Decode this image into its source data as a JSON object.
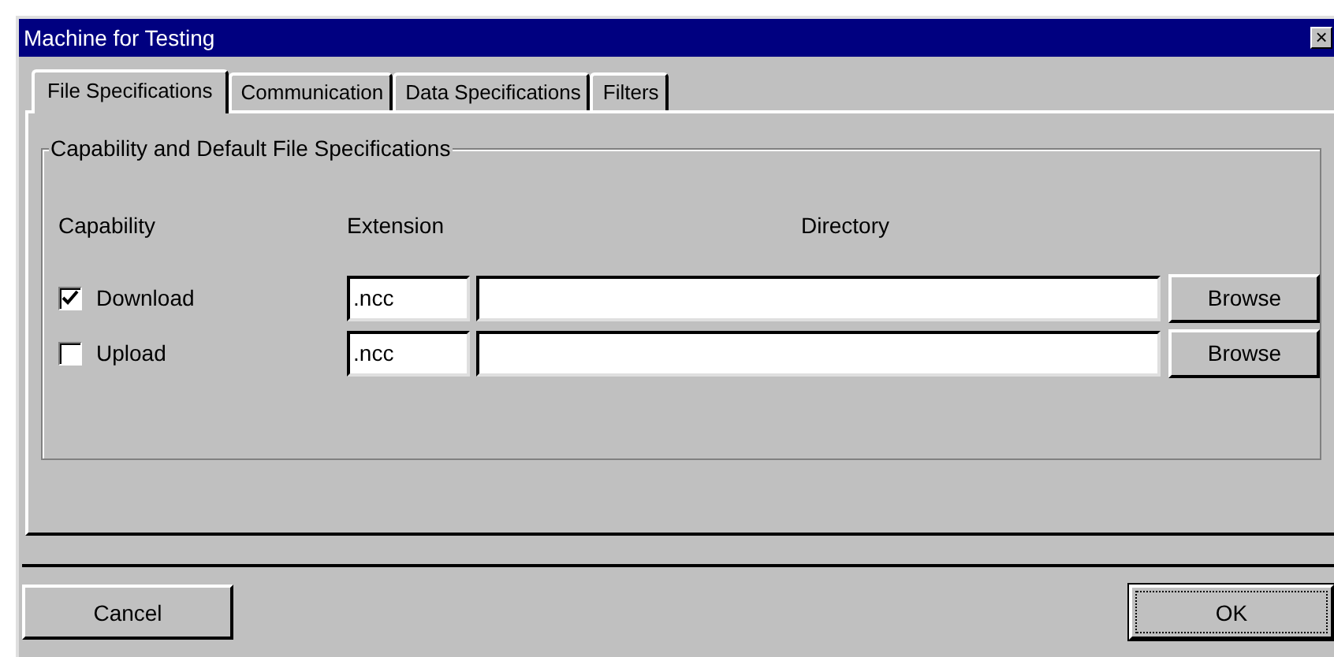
{
  "window": {
    "title": "Machine for Testing",
    "close": "×"
  },
  "tabs": [
    {
      "label": "File Specifications",
      "selected": true
    },
    {
      "label": "Communication",
      "selected": false
    },
    {
      "label": "Data Specifications",
      "selected": false
    },
    {
      "label": "Filters",
      "selected": false
    }
  ],
  "group": {
    "title": "Capability and Default File Specifications",
    "columns": [
      "Capability",
      "Extension",
      "Directory"
    ],
    "rows": [
      {
        "label": "Download",
        "checked": true,
        "extension": ".ncc",
        "button": "Browse"
      },
      {
        "label": "Upload",
        "checked": false,
        "extension": ".ncc",
        "button": "Browse"
      }
    ]
  },
  "buttons": [
    {
      "label": "Cancel",
      "default": false
    },
    {
      "label": "OK",
      "default": true
    }
  ]
}
